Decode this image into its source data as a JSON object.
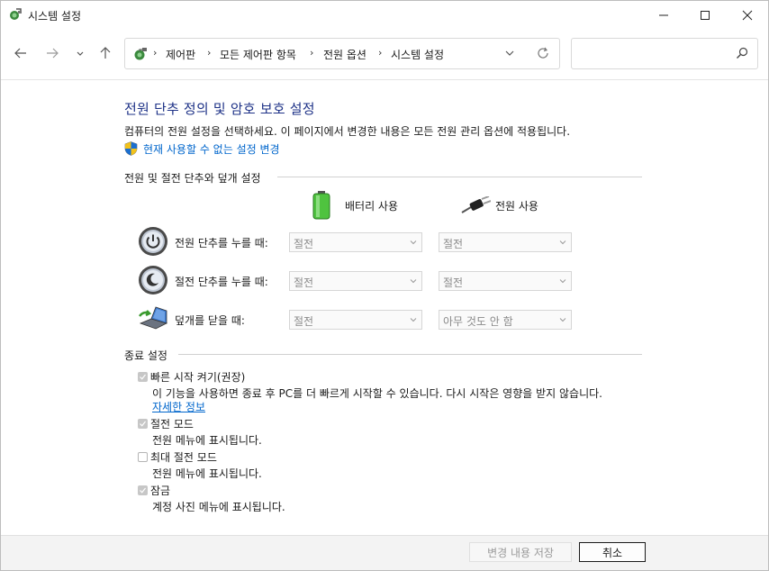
{
  "window": {
    "title": "시스템 설정",
    "controls": [
      "minimize",
      "maximize",
      "close"
    ]
  },
  "nav": {
    "breadcrumbs": [
      "제어판",
      "모든 제어판 항목",
      "전원 옵션",
      "시스템 설정"
    ],
    "search_placeholder": ""
  },
  "page": {
    "title": "전원 단추 정의 및 암호 보호 설정",
    "description": "컴퓨터의 전원 설정을 선택하세요. 이 페이지에서 변경한 내용은 모든 전원 관리 옵션에 적용됩니다.",
    "change_link": "현재 사용할 수 없는 설정 변경"
  },
  "buttons_section": {
    "heading": "전원 및 절전 단추와 덮개 설정",
    "columns": {
      "battery": "배터리 사용",
      "plugged": "전원 사용"
    },
    "rows": [
      {
        "label": "전원 단추를 누를 때:",
        "battery": "절전",
        "plugged": "절전"
      },
      {
        "label": "절전 단추를 누를 때:",
        "battery": "절전",
        "plugged": "절전"
      },
      {
        "label": "덮개를 닫을 때:",
        "battery": "절전",
        "plugged": "아무 것도 안 함"
      }
    ]
  },
  "shutdown_section": {
    "heading": "종료 설정",
    "items": [
      {
        "label": "빠른 시작 켜기(권장)",
        "checked": true,
        "desc": "이 기능을 사용하면 종료 후 PC를 더 빠르게 시작할 수 있습니다. 다시 시작은 영향을 받지 않습니다.",
        "link": "자세한 정보"
      },
      {
        "label": "절전 모드",
        "checked": true,
        "desc": "전원 메뉴에 표시됩니다."
      },
      {
        "label": "최대 절전 모드",
        "checked": false,
        "desc": "전원 메뉴에 표시됩니다."
      },
      {
        "label": "잠금",
        "checked": true,
        "desc": "계정 사진 메뉴에 표시됩니다."
      }
    ]
  },
  "footer": {
    "save": "변경 내용 저장",
    "cancel": "취소"
  },
  "colors": {
    "title": "#1e3287",
    "link": "#0066cc",
    "disabled_text": "#8a8a8a"
  }
}
